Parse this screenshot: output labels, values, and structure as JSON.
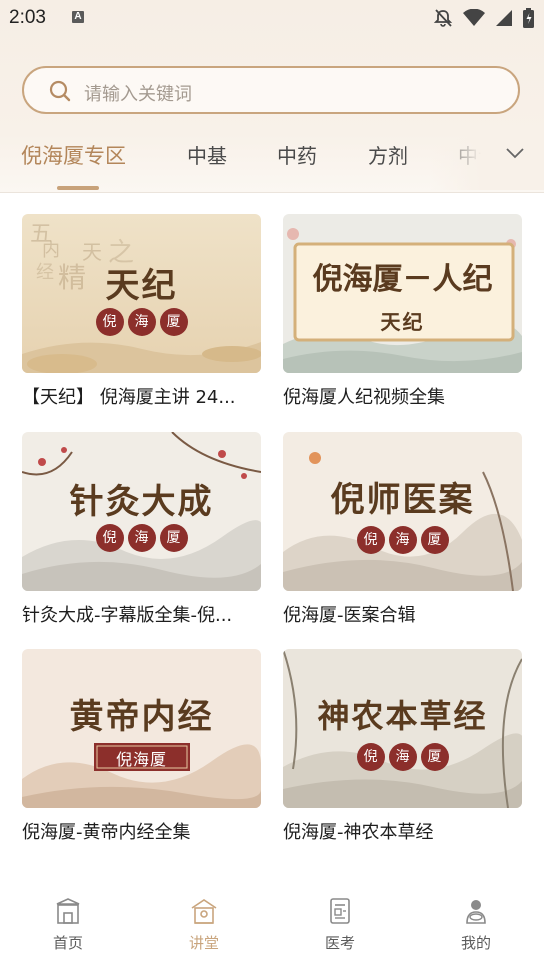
{
  "status_bar": {
    "time": "2:03",
    "a_label": "A"
  },
  "search": {
    "placeholder": "请输入关键词"
  },
  "tabs": [
    {
      "label": "倪海厦专区",
      "active": true
    },
    {
      "label": "中基"
    },
    {
      "label": "中药"
    },
    {
      "label": "方剂"
    },
    {
      "label": "中诊"
    }
  ],
  "cards": [
    {
      "thumb_title": "天纪",
      "thumb_sub": [
        "倪",
        "海",
        "厦"
      ],
      "caption": "【天纪】 倪海厦主讲 24..."
    },
    {
      "thumb_title": "倪海厦－人纪",
      "thumb_sub_text": "天纪",
      "caption": "倪海厦人纪视频全集"
    },
    {
      "thumb_title": "针灸大成",
      "thumb_sub": [
        "倪",
        "海",
        "厦"
      ],
      "caption": "针灸大成-字幕版全集-倪..."
    },
    {
      "thumb_title": "倪师医案",
      "thumb_sub": [
        "倪",
        "海",
        "厦"
      ],
      "caption": "倪海厦-医案合辑"
    },
    {
      "thumb_title": "黄帝内经",
      "thumb_sub_text": "倪海厦",
      "caption": "倪海厦-黄帝内经全集"
    },
    {
      "thumb_title": "神农本草经",
      "thumb_sub": [
        "倪",
        "海",
        "厦"
      ],
      "caption": "倪海厦-神农本草经"
    }
  ],
  "thumb1_bg_chars": [
    "五",
    "内",
    "经",
    "天",
    "精",
    "之"
  ],
  "bottom_nav": [
    {
      "label": "首页",
      "icon": "home-icon"
    },
    {
      "label": "讲堂",
      "icon": "lecture-hall-icon",
      "active": true
    },
    {
      "label": "医考",
      "icon": "exam-icon"
    },
    {
      "label": "我的",
      "icon": "profile-icon"
    }
  ],
  "colors": {
    "accent": "#c8a27a",
    "seal": "#8c2f2b",
    "title_brown": "#5a3b1f"
  }
}
